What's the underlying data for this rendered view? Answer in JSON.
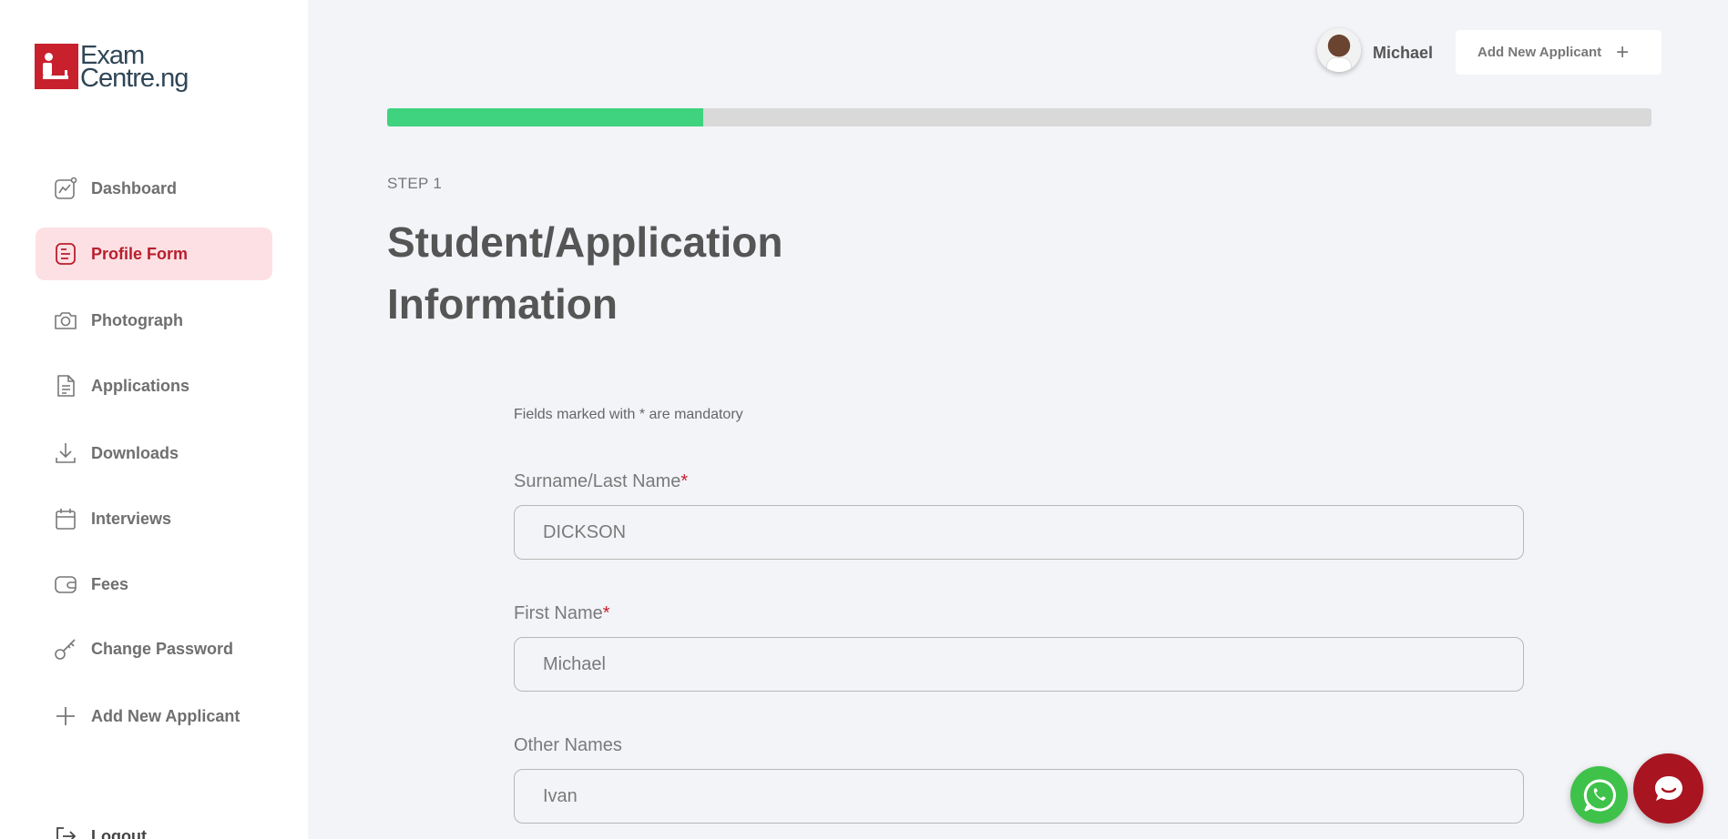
{
  "brand": {
    "line1": "Exam",
    "line2": "Centre.ng",
    "color": "#c8202d"
  },
  "sidebar": {
    "items": [
      {
        "label": "Dashboard",
        "icon": "dashboard-chart-icon",
        "active": false
      },
      {
        "label": "Profile Form",
        "icon": "form-icon",
        "active": true
      },
      {
        "label": "Photograph",
        "icon": "camera-icon",
        "active": false
      },
      {
        "label": "Applications",
        "icon": "document-icon",
        "active": false
      },
      {
        "label": "Downloads",
        "icon": "download-icon",
        "active": false
      },
      {
        "label": "Interviews",
        "icon": "calendar-icon",
        "active": false
      },
      {
        "label": "Fees",
        "icon": "wallet-icon",
        "active": false
      },
      {
        "label": "Change Password",
        "icon": "key-icon",
        "active": false
      },
      {
        "label": "Add New Applicant",
        "icon": "plus-icon",
        "active": false
      },
      {
        "label": "Logout",
        "icon": "logout-icon",
        "active": false
      }
    ]
  },
  "header": {
    "user_name": "Michael",
    "add_button_label": "Add New Applicant",
    "add_button_icon": "plus-icon"
  },
  "progress": {
    "percent": 25,
    "color": "#3fd37f"
  },
  "form": {
    "step": "STEP 1",
    "title": "Student/Application Information",
    "mandatory_note": "Fields marked with * are mandatory",
    "fields": [
      {
        "label": "Surname/Last Name",
        "required": "*",
        "value": "DICKSON"
      },
      {
        "label": "First Name",
        "required": "*",
        "value": "Michael"
      },
      {
        "label": "Other Names",
        "required": "",
        "value": "Ivan"
      }
    ]
  },
  "floating": {
    "whatsapp_icon": "whatsapp-icon",
    "chat_icon": "chat-bubble-icon",
    "whatsapp_color": "#3fc24a",
    "chat_color": "#a8141f"
  }
}
